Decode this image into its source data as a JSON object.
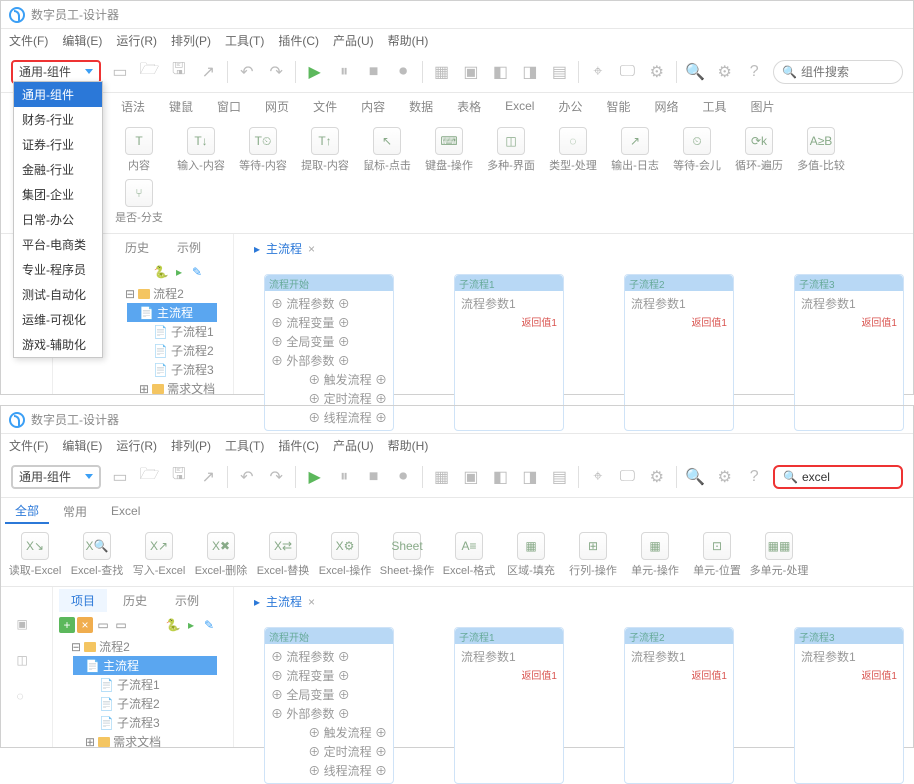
{
  "title": "数字员工-设计器",
  "menus": [
    "文件(F)",
    "编辑(E)",
    "运行(R)",
    "排列(P)",
    "工具(T)",
    "插件(C)",
    "产品(U)",
    "帮助(H)"
  ],
  "dropdown": {
    "label": "通用-组件",
    "items": [
      "通用-组件",
      "财务-行业",
      "证券-行业",
      "金融-行业",
      "集团-企业",
      "日常-办公",
      "平台-电商类",
      "专业-程序员",
      "测试-自动化",
      "运维-可视化",
      "游戏-辅助化"
    ]
  },
  "search": {
    "placeholder": "组件搜索",
    "value": ""
  },
  "search2": {
    "value": "excel"
  },
  "cattabs": [
    "全部",
    "常用",
    "语法",
    "键鼠",
    "窗口",
    "网页",
    "文件",
    "内容",
    "数据",
    "表格",
    "Excel",
    "办公",
    "智能",
    "网络",
    "工具",
    "图片"
  ],
  "cattabs2": [
    "全部",
    "常用",
    "Excel"
  ],
  "mods": [
    "内容",
    "输入-内容",
    "等待-内容",
    "提取-内容",
    "鼠标-点击",
    "键盘-操作",
    "多种-界面",
    "类型-处理",
    "输出-日志",
    "等待-会儿",
    "循环-遍历",
    "多值-比较",
    "是否-分支"
  ],
  "mods2": [
    "读取-Excel",
    "Excel-查找",
    "写入-Excel",
    "Excel-删除",
    "Excel-替换",
    "Excel-操作",
    "Sheet-操作",
    "Excel-格式",
    "区域-填充",
    "行列-操作",
    "单元-操作",
    "单元-位置",
    "多单元-处理"
  ],
  "projtabs": [
    "项目",
    "历史",
    "示例"
  ],
  "tree": {
    "root": "流程2",
    "main": "主流程",
    "subs": [
      "子流程1",
      "子流程2",
      "子流程3"
    ],
    "doc": "需求文档"
  },
  "canvastab": "主流程",
  "flow": {
    "n1": {
      "title": "流程开始",
      "rows": [
        "流程参数",
        "流程变量",
        "全局变量",
        "外部参数"
      ],
      "extras": [
        "触发流程",
        "定时流程",
        "线程流程"
      ]
    },
    "n2": {
      "title": "子流程1",
      "rows": [
        "流程参数1"
      ],
      "ret": "返回值1"
    },
    "n3": {
      "title": "子流程2",
      "rows": [
        "流程参数1"
      ],
      "ret": "返回值1"
    },
    "n4": {
      "title": "子流程3",
      "rows": [
        "流程参数1"
      ],
      "ret": "返回值1"
    }
  }
}
